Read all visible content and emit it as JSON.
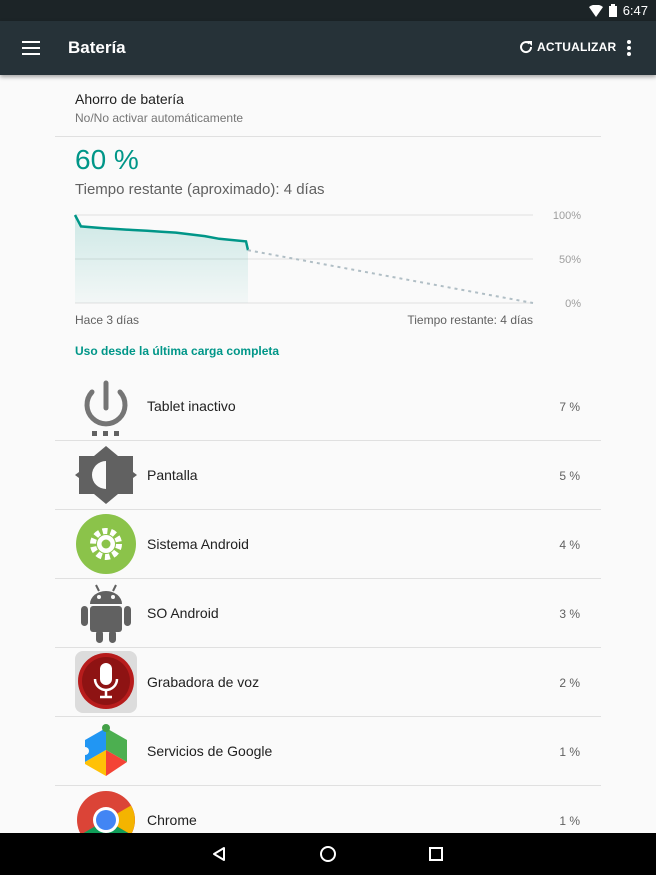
{
  "status_bar": {
    "time": "6:47"
  },
  "app_bar": {
    "title": "Batería",
    "refresh_label": "ACTUALIZAR"
  },
  "battery_saver": {
    "title": "Ahorro de batería",
    "subtitle": "No/No activar automáticamente"
  },
  "battery": {
    "level_text": "60 %",
    "remaining_text": "Tiempo restante (aproximado): 4 días"
  },
  "graph": {
    "y_labels": [
      "100%",
      "50%",
      "0%"
    ],
    "x_start_label": "Hace 3 días",
    "x_end_label": "Tiempo restante: 4 días"
  },
  "chart_data": {
    "type": "line",
    "x_start": "Hace 3 días",
    "x_end": "Tiempo restante: 4 días",
    "ylim": [
      0,
      100
    ],
    "series": [
      {
        "values": [
          100,
          87,
          85,
          84,
          83,
          82,
          81,
          80,
          78,
          76,
          73,
          70,
          60
        ]
      },
      {
        "values": [
          60,
          0
        ]
      }
    ]
  },
  "usage_section": {
    "title": "Uso desde la última carga completa"
  },
  "usage_items": [
    {
      "name": "Tablet inactivo",
      "value": "7 %",
      "icon": "power-icon"
    },
    {
      "name": "Pantalla",
      "value": "5 %",
      "icon": "brightness-icon"
    },
    {
      "name": "Sistema Android",
      "value": "4 %",
      "icon": "android-system-icon"
    },
    {
      "name": "SO Android",
      "value": "3 %",
      "icon": "android-robot-icon"
    },
    {
      "name": "Grabadora de voz",
      "value": "2 %",
      "icon": "voice-recorder-icon"
    },
    {
      "name": "Servicios de Google",
      "value": "1 %",
      "icon": "google-play-services-icon"
    },
    {
      "name": "Chrome",
      "value": "1 %",
      "icon": "chrome-icon"
    }
  ],
  "colors": {
    "accent": "#009688",
    "toolbar": "#263238",
    "statusbar": "#1c2427"
  }
}
